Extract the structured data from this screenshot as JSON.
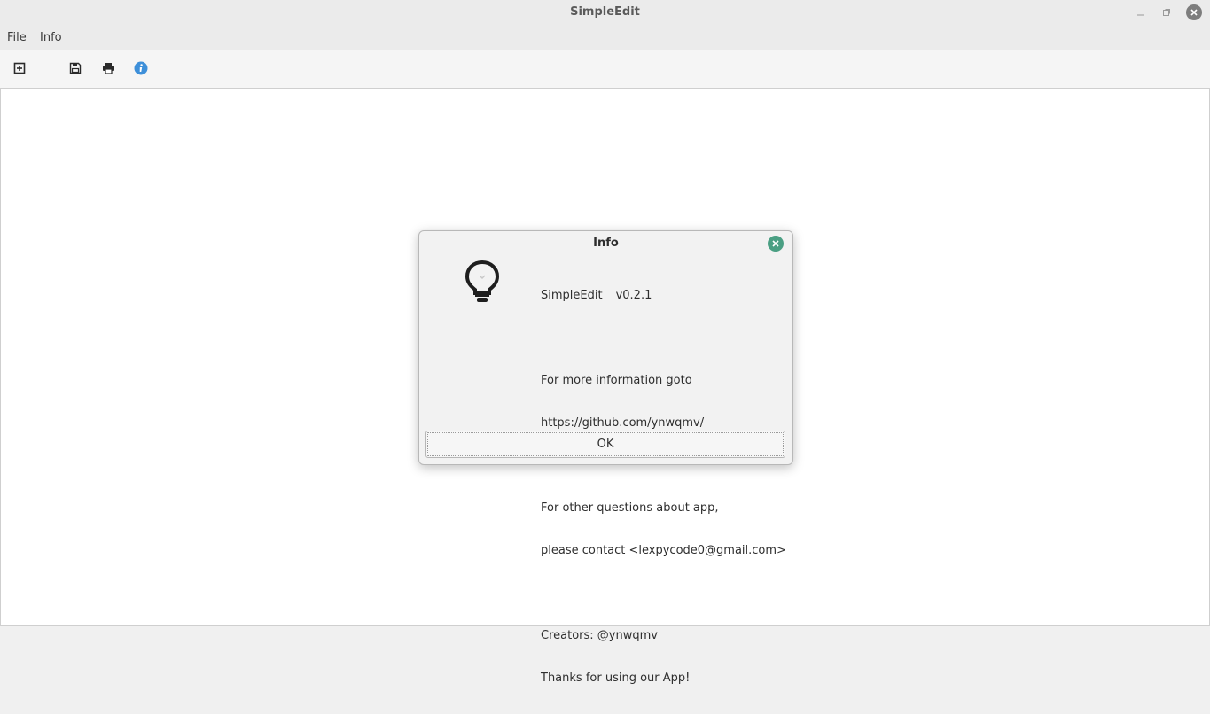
{
  "window": {
    "title": "SimpleEdit"
  },
  "menu": {
    "items": [
      {
        "label": "File"
      },
      {
        "label": "Info"
      }
    ]
  },
  "toolbar": {
    "buttons": [
      {
        "icon": "new-document-icon"
      },
      {
        "icon": "save-icon"
      },
      {
        "icon": "print-icon"
      },
      {
        "icon": "info-icon"
      }
    ]
  },
  "dialog": {
    "title": "Info",
    "icon": "lightbulb-icon",
    "app_name": "SimpleEdit",
    "version": "v0.2.1",
    "more_info_line": "For more information goto",
    "url": "https://github.com/ynwqmv/",
    "questions_line": "For other questions about app,",
    "contact_line": "please contact <lexpycode0@gmail.com>",
    "creators_line": "Creators: @ynwqmv",
    "thanks_line": "Thanks for using our App!",
    "ok_label": "OK"
  },
  "colors": {
    "dialog_close": "#4a9f83",
    "info_icon": "#3d8fd9"
  }
}
